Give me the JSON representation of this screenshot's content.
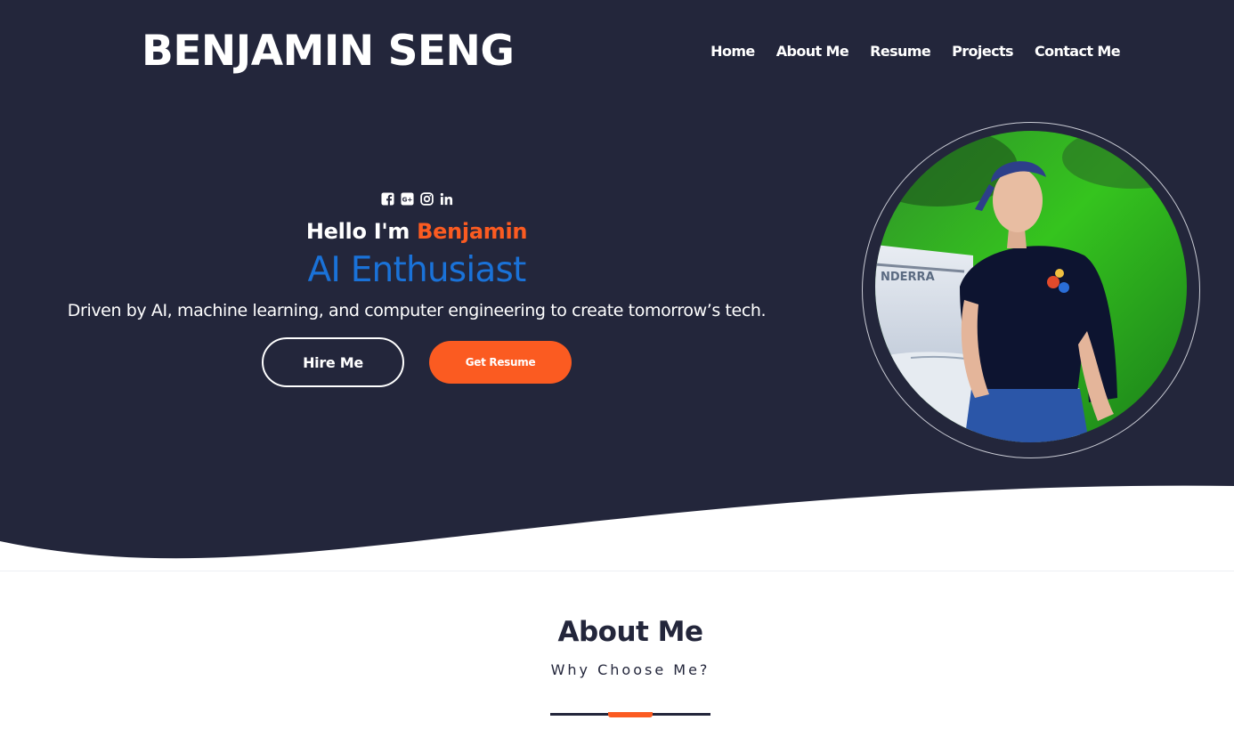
{
  "brand": "BENJAMIN SENG",
  "nav": {
    "items": [
      "Home",
      "About Me",
      "Resume",
      "Projects",
      "Contact Me"
    ]
  },
  "social_icons": [
    "facebook-icon",
    "google-plus-icon",
    "instagram-icon",
    "linkedin-icon"
  ],
  "hero": {
    "greeting": "Hello I'm",
    "name": "Benjamin",
    "role": "AI Enthusiast",
    "tagline": "Driven by AI, machine learning, and computer engineering to create tomorrow’s tech.",
    "hire_label": "Hire Me",
    "resume_label": "Get Resume"
  },
  "about": {
    "title": "About Me",
    "subtitle": "Why Choose Me?"
  },
  "colors": {
    "hero_bg": "#23263b",
    "accent_orange": "#fb5b21",
    "accent_blue": "#1a72d8",
    "text_light": "#ffffff"
  }
}
